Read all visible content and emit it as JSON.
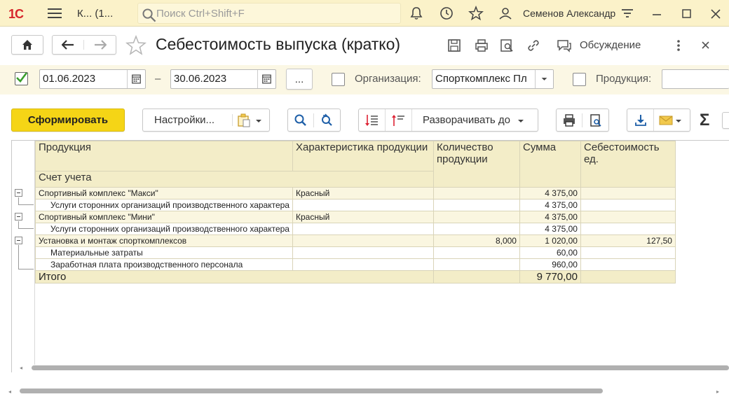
{
  "appbar": {
    "logo": "1С",
    "title": "К...  (1...",
    "search_placeholder": "Поиск Ctrl+Shift+F",
    "user": "Семенов Александр"
  },
  "toolbar": {
    "title": "Себестоимость выпуска (кратко)",
    "discussion": "Обсуждение"
  },
  "params": {
    "period_enabled": true,
    "date_from": "01.06.2023",
    "dash": "–",
    "date_to": "30.06.2023",
    "more": "...",
    "org_label": "Организация:",
    "org_value": "Спорткомплекс Пл",
    "product_label": "Продукция:",
    "product_value": ""
  },
  "commands": {
    "generate": "Сформировать",
    "settings": "Настройки...",
    "expand_to": "Разворачивать до"
  },
  "report": {
    "headers": {
      "product": "Продукция",
      "characteristic": "Характеристика продукции",
      "quantity": "Количество продукции",
      "sum": "Сумма",
      "unit_cost": "Себестоимость ед.",
      "account": "Счет учета"
    },
    "rows": [
      {
        "kind": "grp",
        "product": "Спортивный комплекс \"Макси\"",
        "characteristic": "Красный",
        "quantity": "",
        "sum": "4 375,00",
        "unit_cost": ""
      },
      {
        "kind": "sub",
        "product": "Услуги сторонних организаций производственного характера",
        "characteristic": "",
        "quantity": "",
        "sum": "4 375,00",
        "unit_cost": ""
      },
      {
        "kind": "grp",
        "product": "Спортивный комплекс \"Мини\"",
        "characteristic": "Красный",
        "quantity": "",
        "sum": "4 375,00",
        "unit_cost": ""
      },
      {
        "kind": "sub",
        "product": "Услуги сторонних организаций производственного характера",
        "characteristic": "",
        "quantity": "",
        "sum": "4 375,00",
        "unit_cost": ""
      },
      {
        "kind": "grp",
        "product": "Установка и монтаж спорткомплексов",
        "characteristic": "",
        "quantity": "8,000",
        "sum": "1 020,00",
        "unit_cost": "127,50"
      },
      {
        "kind": "sub",
        "product": "Материальные затраты",
        "characteristic": "",
        "quantity": "",
        "sum": "60,00",
        "unit_cost": ""
      },
      {
        "kind": "sub",
        "product": "Заработная плата производственного персонала",
        "characteristic": "",
        "quantity": "",
        "sum": "960,00",
        "unit_cost": ""
      }
    ],
    "total_label": "Итого",
    "total_sum": "9 770,00"
  },
  "colors": {
    "accent_yellow": "#f5d516",
    "appbar_bg": "#fbf2c9",
    "header_bg": "#f3edc8",
    "check_green": "#3a9e2c"
  }
}
